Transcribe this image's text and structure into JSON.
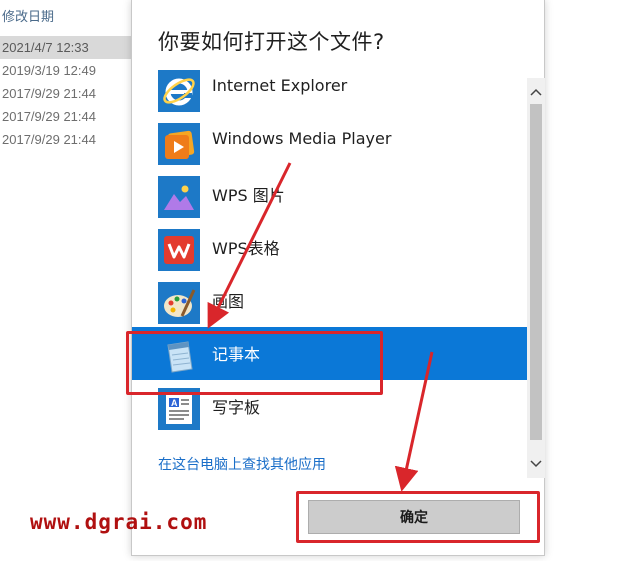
{
  "explorer": {
    "column_header": "修改日期",
    "rows": [
      {
        "date": "2021/4/7 12:33",
        "selected": true
      },
      {
        "date": "2019/3/19 12:49",
        "selected": false
      },
      {
        "date": "2017/9/29 21:44",
        "selected": false
      },
      {
        "date": "2017/9/29 21:44",
        "selected": false
      },
      {
        "date": "2017/9/29 21:44",
        "selected": false
      }
    ]
  },
  "dialog": {
    "title": "你要如何打开这个文件?",
    "apps": [
      {
        "label": "Internet Explorer",
        "icon": "internet-explorer-icon"
      },
      {
        "label": "Windows Media Player",
        "icon": "windows-media-player-icon"
      },
      {
        "label": "WPS 图片",
        "icon": "wps-picture-icon"
      },
      {
        "label": "WPS表格",
        "icon": "wps-spreadsheet-icon"
      },
      {
        "label": "画图",
        "icon": "paint-icon"
      },
      {
        "label": "记事本",
        "icon": "notepad-icon",
        "selected": true
      },
      {
        "label": "写字板",
        "icon": "wordpad-icon"
      }
    ],
    "more_apps_link": "在这台电脑上查找其他应用",
    "ok_button": "确定"
  },
  "colors": {
    "selection": "#0b78d7",
    "annotation_red": "#d9262b",
    "link": "#1a6ec8"
  },
  "watermark": "www.dgrai.com"
}
